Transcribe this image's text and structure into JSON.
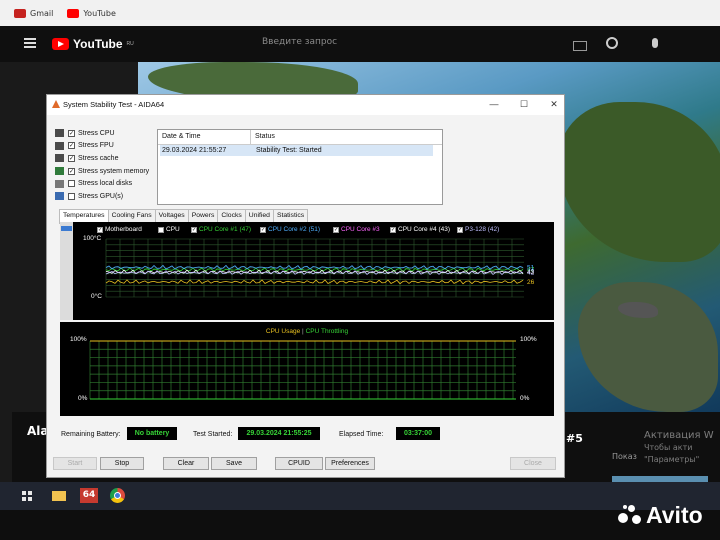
{
  "browser": {
    "bookmarks": [
      {
        "label": "Gmail",
        "icon": "gmail-icon",
        "color": "#c5221f"
      },
      {
        "label": "YouTube",
        "icon": "youtube-icon",
        "color": "#ff0000"
      }
    ]
  },
  "youtube": {
    "logo_text": "YouTube",
    "logo_region": "RU",
    "search_placeholder": "Введите запрос",
    "video_title_fragment": "Ala",
    "video_title_fragment_right": "#5"
  },
  "activation": {
    "title": "Активация W",
    "line1": "Чтобы акти",
    "line2": "\"Параметры\"",
    "overlay_left": "Показ"
  },
  "aida": {
    "title": "System Stability Test - AIDA64",
    "stress_options": [
      {
        "label": "Stress CPU",
        "checked": true,
        "icon_color": "#4a4a4a"
      },
      {
        "label": "Stress FPU",
        "checked": true,
        "icon_color": "#4a4a4a"
      },
      {
        "label": "Stress cache",
        "checked": true,
        "icon_color": "#4a4a4a"
      },
      {
        "label": "Stress system memory",
        "checked": true,
        "icon_color": "#2f7a3a"
      },
      {
        "label": "Stress local disks",
        "checked": false,
        "icon_color": "#777777"
      },
      {
        "label": "Stress GPU(s)",
        "checked": false,
        "icon_color": "#3a6ab0"
      }
    ],
    "log": {
      "col_date": "Date & Time",
      "col_status": "Status",
      "rows": [
        {
          "date": "29.03.2024 21:55:27",
          "status": "Stability Test: Started"
        }
      ]
    },
    "tabs": [
      "Temperatures",
      "Cooling Fans",
      "Voltages",
      "Powers",
      "Clocks",
      "Unified",
      "Statistics"
    ],
    "active_tab": "Temperatures",
    "temp_graph": {
      "ymax_label": "100°C",
      "ymin_label": "0°C",
      "legend": [
        {
          "label": "Motherboard",
          "color": "#ffffff",
          "checked": true
        },
        {
          "label": "CPU",
          "color": "#ffffff",
          "checked": false
        },
        {
          "label": "CPU Core #1 (47)",
          "color": "#37d337",
          "checked": true
        },
        {
          "label": "CPU Core #2 (51)",
          "color": "#4fb0ff",
          "checked": true
        },
        {
          "label": "CPU Core #3",
          "color": "#ff66ff",
          "checked": true
        },
        {
          "label": "CPU Core #4 (43)",
          "color": "#ffffff",
          "checked": true
        },
        {
          "label": "P3-128 (42)",
          "color": "#bfbfff",
          "checked": true
        }
      ],
      "right_values": [
        "47",
        "51",
        "43",
        "42",
        "26"
      ],
      "series_level_pct": [
        47,
        51,
        43,
        42,
        26
      ],
      "grid_color": "#2e5a2e"
    },
    "cpu_graph": {
      "title_usage": "CPU Usage",
      "separator": "|",
      "title_throttling": "CPU Throttling",
      "usage_color": "#e8c020",
      "throttling_color": "#37d337",
      "ymax_left": "100%",
      "ymin_left": "0%",
      "ymax_right": "100%",
      "ymin_right": "0%",
      "usage_level_pct": 100,
      "throttling_level_pct": 0
    },
    "status": {
      "battery_label": "Remaining Battery:",
      "battery_value": "No battery",
      "started_label": "Test Started:",
      "started_value": "29.03.2024 21:55:25",
      "elapsed_label": "Elapsed Time:",
      "elapsed_value": "03:37:00"
    },
    "buttons": {
      "start": "Start",
      "stop": "Stop",
      "clear": "Clear",
      "save": "Save",
      "cpuid": "CPUID",
      "preferences": "Preferences",
      "close": "Close"
    }
  },
  "taskbar": {
    "aida_icon_text": "64"
  },
  "watermark": {
    "text": "Avito"
  }
}
